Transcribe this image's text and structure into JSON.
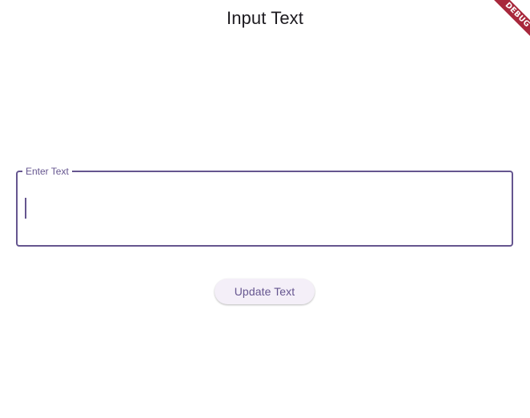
{
  "appbar": {
    "title": "Input Text"
  },
  "text_field": {
    "label": "Enter Text",
    "value": ""
  },
  "update_button": {
    "label": "Update Text"
  },
  "debug_banner": {
    "label": "DEBUG"
  },
  "colors": {
    "primary": "#65558f",
    "button_bg": "#f4eff8",
    "title_text": "#1d1b20",
    "debug_banner": "#a8283c",
    "background": "#ffffff"
  }
}
